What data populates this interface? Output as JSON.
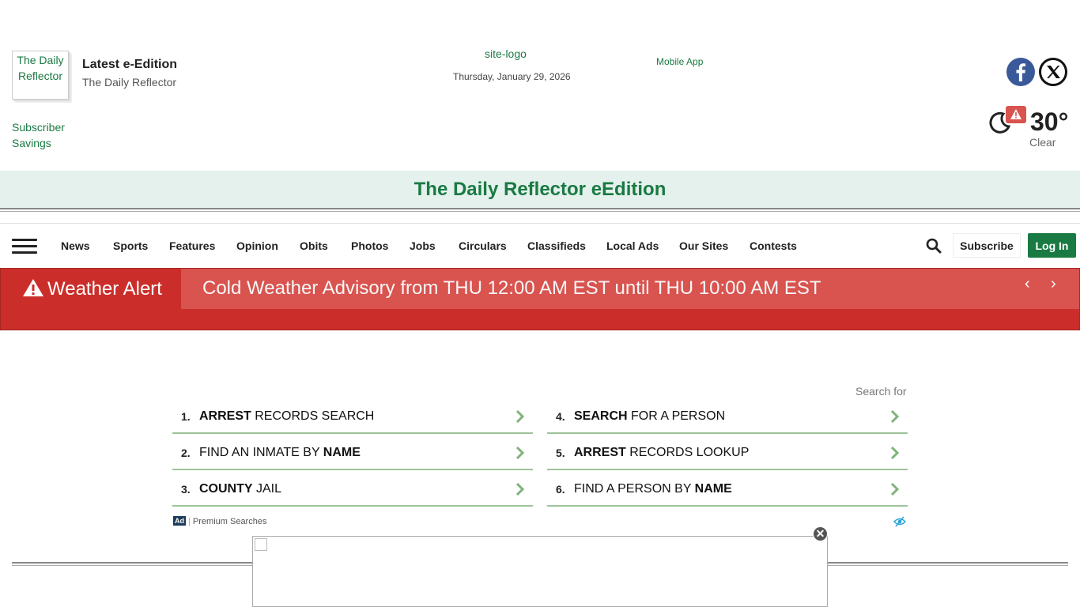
{
  "header": {
    "eedition_thumb_alt": "The Daily Reflector",
    "eedition_title": "Latest e-Edition",
    "eedition_subtitle": "The Daily Reflector",
    "subscriber_savings": "Subscriber Savings",
    "site_logo_alt": "site-logo",
    "date": "Thursday, January 29, 2026",
    "mobile_app": "Mobile App",
    "social": {
      "facebook_icon": "facebook-icon",
      "x_icon": "x-twitter-icon"
    },
    "weather": {
      "temperature": "30°",
      "condition": "Clear",
      "icon": "moon-icon",
      "alert_icon": "warning-icon"
    }
  },
  "banner": {
    "title": "The Daily Reflector eEdition"
  },
  "nav": {
    "items": [
      "News",
      "Sports",
      "Features",
      "Opinion",
      "Obits",
      "Photos",
      "Jobs",
      "Circulars",
      "Classifieds",
      "Local Ads",
      "Our Sites",
      "Contests"
    ],
    "subscribe": "Subscribe",
    "login": "Log In"
  },
  "alert": {
    "label": "Weather Alert",
    "message": "Cold Weather Advisory from THU 12:00 AM EST until THU 10:00 AM EST",
    "prev": "‹",
    "next": "›"
  },
  "ad": {
    "search_for": "Search for",
    "items": [
      {
        "num": "1.",
        "bold": "ARREST",
        "rest": " RECORDS SEARCH"
      },
      {
        "num": "2.",
        "pre": "FIND AN INMATE BY ",
        "bold": "NAME"
      },
      {
        "num": "3.",
        "bold": "COUNTY",
        "rest": " JAIL"
      },
      {
        "num": "4.",
        "bold": "SEARCH",
        "rest": " FOR A PERSON"
      },
      {
        "num": "5.",
        "bold": "ARREST",
        "rest": " RECORDS LOOKUP"
      },
      {
        "num": "6.",
        "pre": "FIND A PERSON BY ",
        "bold": "NAME"
      }
    ],
    "badge": "Ad",
    "footer": "Premium Searches"
  },
  "sticky_ad": {
    "close": "✕"
  },
  "colors": {
    "brand_green": "#1a7a43",
    "alert_red": "#cb2e2a",
    "alert_msg_bg": "#d9534f",
    "banner_bg": "#e4f1ec"
  }
}
